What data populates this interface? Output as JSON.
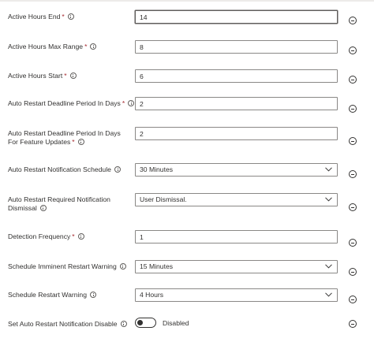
{
  "settings": [
    {
      "label": "Active Hours End",
      "required": true,
      "type": "text",
      "value": "14"
    },
    {
      "label": "Active Hours Max Range",
      "required": true,
      "type": "text",
      "value": "8"
    },
    {
      "label": "Active Hours Start",
      "required": true,
      "type": "text",
      "value": "6"
    },
    {
      "label": "Auto Restart Deadline Period In Days",
      "required": true,
      "type": "text",
      "value": "2"
    },
    {
      "label": "Auto Restart Deadline Period In Days For Feature Updates",
      "required": true,
      "type": "text",
      "value": "2"
    },
    {
      "label": "Auto Restart Notification Schedule",
      "required": false,
      "type": "dropdown",
      "value": "30 Minutes"
    },
    {
      "label": "Auto Restart Required Notification Dismissal",
      "required": false,
      "type": "dropdown",
      "value": "User Dismissal."
    },
    {
      "label": "Detection Frequency",
      "required": true,
      "type": "text",
      "value": "1"
    },
    {
      "label": "Schedule Imminent Restart Warning",
      "required": false,
      "type": "dropdown",
      "value": "15 Minutes"
    },
    {
      "label": "Schedule Restart Warning",
      "required": false,
      "type": "dropdown",
      "value": "4 Hours"
    },
    {
      "label": "Set Auto Restart Notification Disable",
      "required": false,
      "type": "toggle",
      "value": "Disabled",
      "enabled": false
    }
  ],
  "required_marker": "*"
}
